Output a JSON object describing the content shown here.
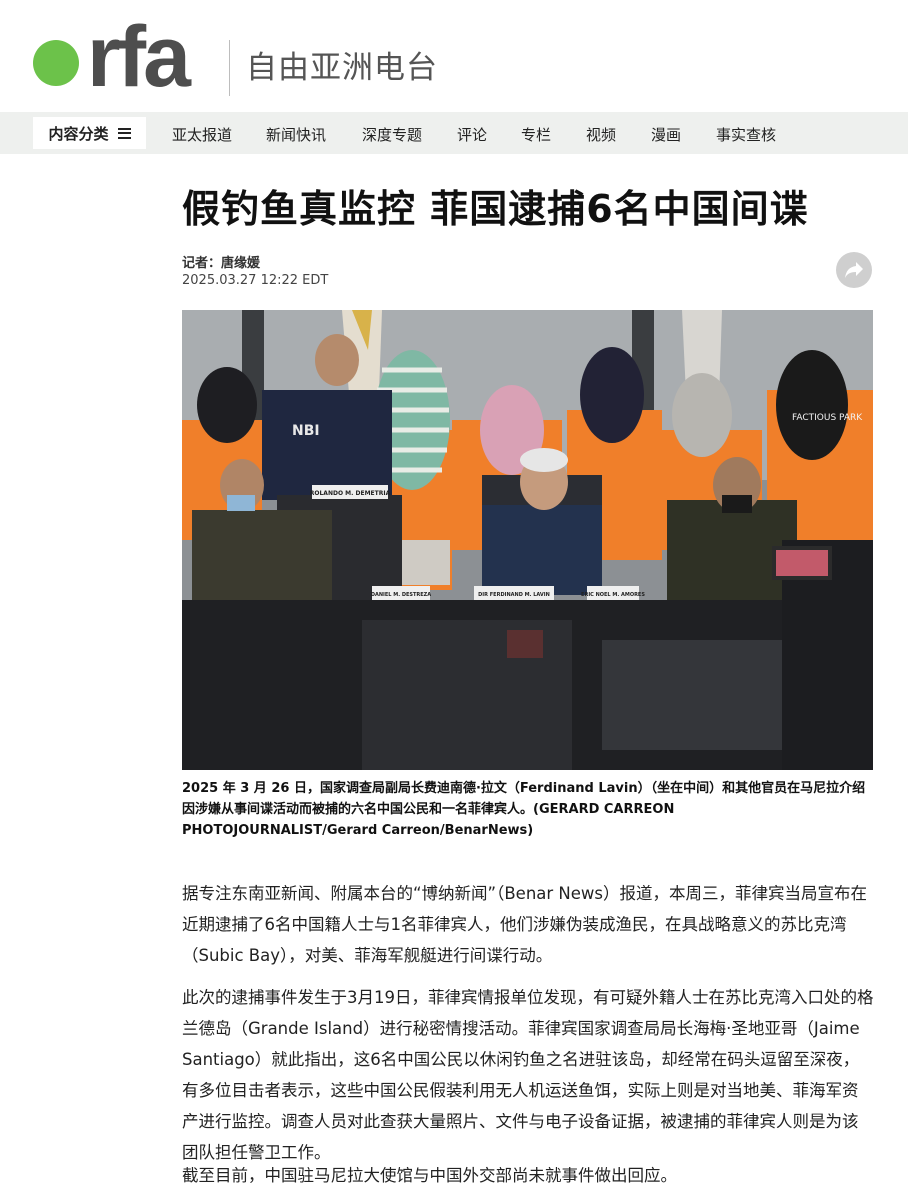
{
  "brand": {
    "logo_text": "rfa",
    "logo_cn": "自由亚洲电台",
    "accent": "#6cc24a"
  },
  "nav": {
    "category_label": "内容分类",
    "items": [
      {
        "label": "亚太报道"
      },
      {
        "label": "新闻快讯"
      },
      {
        "label": "深度专题"
      },
      {
        "label": "评论"
      },
      {
        "label": "专栏"
      },
      {
        "label": "视频"
      },
      {
        "label": "漫画"
      },
      {
        "label": "事实查核"
      }
    ]
  },
  "article": {
    "title": "假钓鱼真监控 菲国逮捕6名中国间谍",
    "author_label": "记者：",
    "author": "唐缘媛",
    "date": "2025.03.27 12:22 EDT",
    "photo": {
      "podium_label": "ROLANDO M. DEMETRIA",
      "name_plates": [
        "DANIEL M. DESTREZA",
        "DIR FERDINAND M. LAVIN",
        "ERIC NOEL M. AMORES"
      ],
      "shirt_text": "FACTIOUS PARK",
      "jacket_text": "NBI"
    },
    "caption": "2025 年 3 月 26 日，国家调查局副局长费迪南德·拉文（Ferdinand Lavin）（坐在中间）和其他官员在马尼拉介绍因涉嫌从事间谍活动而被捕的六名中国公民和一名菲律宾人。(GERARD CARREON PHOTOJOURNALIST/Gerard Carreon/BenarNews)",
    "paragraphs": [
      "据专注东南亚新闻、附属本台的“博纳新闻”（Benar News）报道，本周三，菲律宾当局宣布在近期逮捕了6名中国籍人士与1名菲律宾人，他们涉嫌伪装成渔民，在具战略意义的苏比克湾（Subic Bay），对美、菲海军舰艇进行间谍行动。",
      "此次的逮捕事件发生于3月19日，菲律宾情报单位发现，有可疑外籍人士在苏比克湾入口处的格兰德岛（Grande Island）进行秘密情搜活动。菲律宾国家调查局局长海梅·圣地亚哥（Jaime Santiago）就此指出，这6名中国公民以休闲钓鱼之名进驻该岛，却经常在码头逗留至深夜，有多位目击者表示，这些中国公民假装利用无人机运送鱼饵，实际上则是对当地美、菲海军资产进行监控。调查人员对此查获大量照片、文件与电子设备证据，被逮捕的菲律宾人则是为该团队担任警卫工作。",
      "截至目前，中国驻马尼拉大使馆与中国外交部尚未就事件做出回应。"
    ]
  }
}
